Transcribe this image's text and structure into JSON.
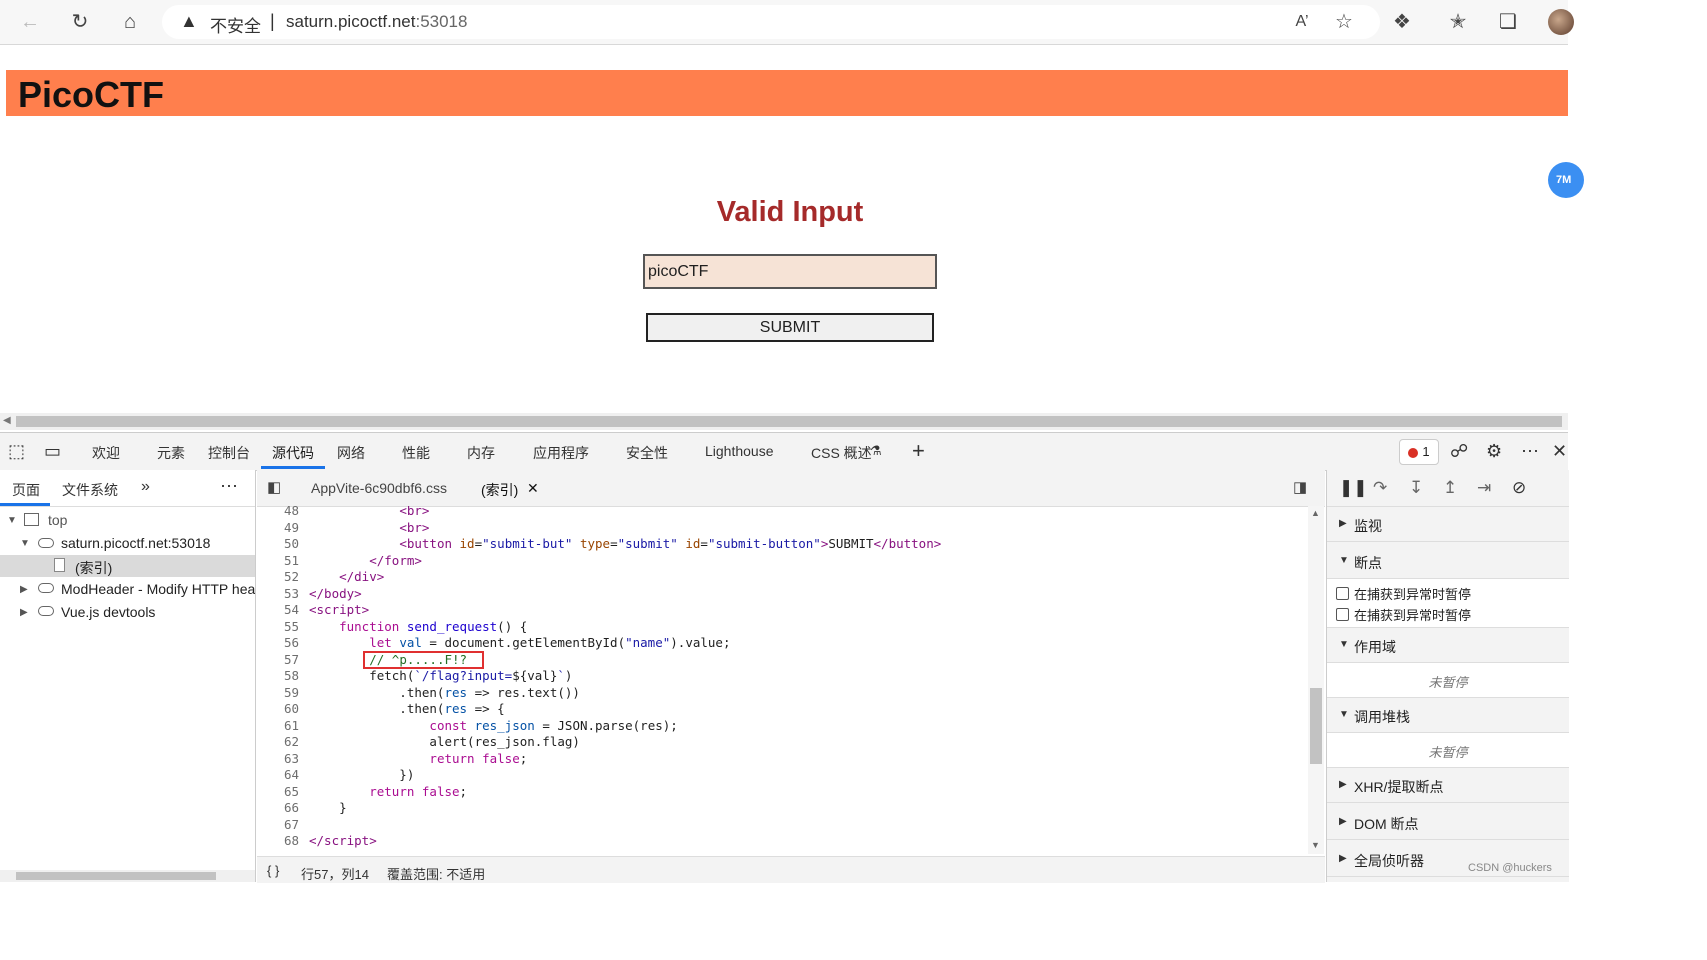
{
  "browser": {
    "security_label": "不安全",
    "url_host": "saturn.picoctf.net",
    "url_port": ":53018",
    "separator": "|"
  },
  "page": {
    "banner_title": "PicoCTF",
    "heading": "Valid Input",
    "input_value": "picoCTF",
    "submit_label": "SUBMIT",
    "bubble_text": "7M"
  },
  "devtools": {
    "tabs": [
      "欢迎",
      "元素",
      "控制台",
      "源代码",
      "网络",
      "性能",
      "内存",
      "应用程序",
      "安全性",
      "Lighthouse",
      "CSS 概述"
    ],
    "active_tab": "源代码",
    "error_count": "1",
    "navigator": {
      "tabs": [
        "页面",
        "文件系统"
      ],
      "tree": [
        "top",
        "saturn.picoctf.net:53018",
        "(索引)",
        "ModHeader - Modify HTTP head",
        "Vue.js devtools"
      ]
    },
    "editor": {
      "tabs": [
        "AppVite-6c90dbf6.css",
        "(索引)"
      ],
      "status": "行57，列14",
      "coverage": "覆盖范围: 不适用",
      "lines": [
        {
          "n": "48"
        },
        {
          "n": "49"
        },
        {
          "n": "50"
        },
        {
          "n": "51"
        },
        {
          "n": "52"
        },
        {
          "n": "53"
        },
        {
          "n": "54"
        },
        {
          "n": "55"
        },
        {
          "n": "56"
        },
        {
          "n": "57"
        },
        {
          "n": "58"
        },
        {
          "n": "59"
        },
        {
          "n": "60"
        },
        {
          "n": "61"
        },
        {
          "n": "62"
        },
        {
          "n": "63"
        },
        {
          "n": "64"
        },
        {
          "n": "65"
        },
        {
          "n": "66"
        },
        {
          "n": "67"
        },
        {
          "n": "68"
        }
      ]
    },
    "debugger": {
      "watch": "监视",
      "breakpoints": "断点",
      "pause_uncaught": "在捕获到异常时暂停",
      "pause_caught": "在捕获到异常时暂停",
      "scope": "作用域",
      "not_paused_1": "未暂停",
      "call_stack": "调用堆栈",
      "not_paused_2": "未暂停",
      "xhr": "XHR/提取断点",
      "dom": "DOM 断点",
      "global": "全局侦听器"
    },
    "watermark": "CSDN @huckers"
  }
}
